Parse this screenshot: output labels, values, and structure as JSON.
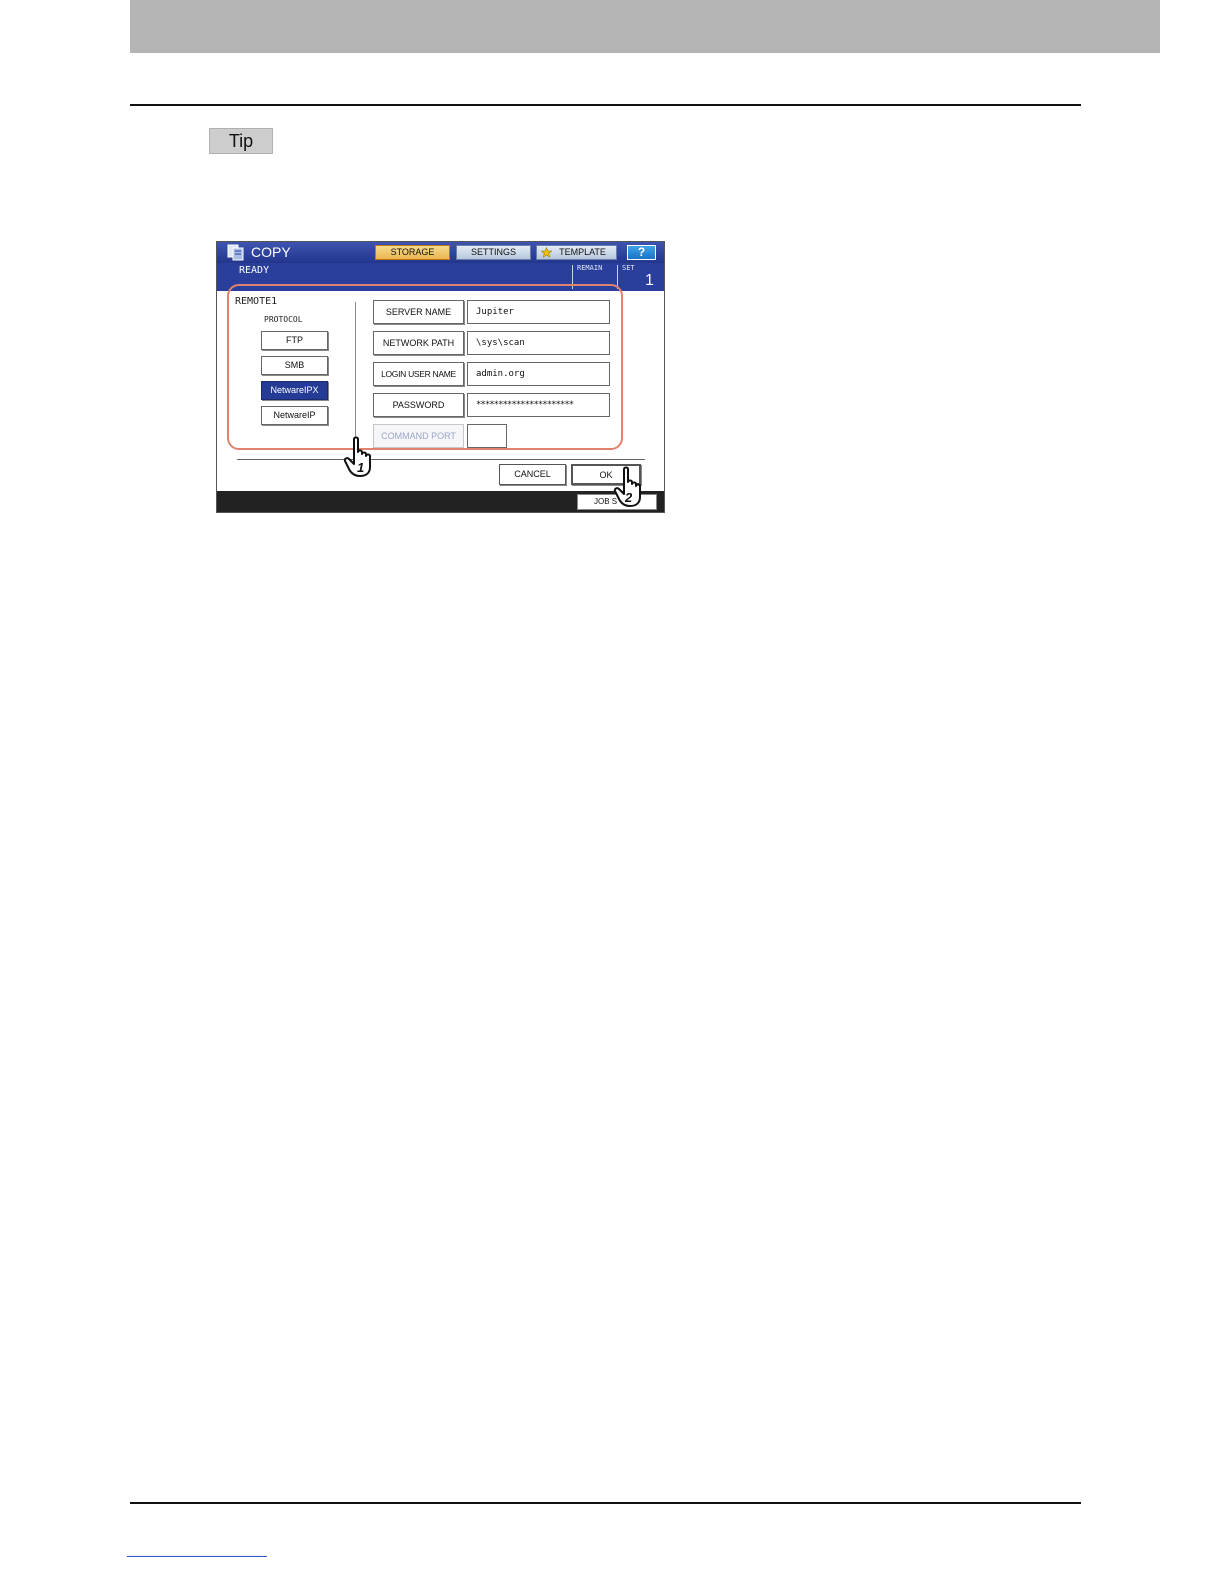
{
  "page": {
    "tip_label": "Tip"
  },
  "panel": {
    "app_title": "COPY",
    "top_buttons": {
      "storage": "STORAGE",
      "settings": "SETTINGS",
      "template": "TEMPLATE",
      "help": "?"
    },
    "status": {
      "text": "READY",
      "remain_label": "REMAIN",
      "set_label": "SET",
      "set_value": "1"
    },
    "remote_title": "REMOTE1",
    "protocol_label": "PROTOCOL",
    "protocols": [
      "FTP",
      "SMB",
      "NetwareIPX",
      "NetwareIP"
    ],
    "selected_protocol": "NetwareIPX",
    "fields": {
      "server_name": {
        "label": "SERVER NAME",
        "value": "Jupiter"
      },
      "network_path": {
        "label": "NETWORK PATH",
        "value": "\\sys\\scan"
      },
      "login_user_name": {
        "label": "LOGIN USER NAME",
        "value": "admin.org"
      },
      "password": {
        "label": "PASSWORD",
        "value": "**********************"
      },
      "command_port": {
        "label": "COMMAND PORT",
        "value": ""
      }
    },
    "actions": {
      "cancel": "CANCEL",
      "ok": "OK"
    },
    "bottom": {
      "job_status": "JOB S"
    },
    "callouts": {
      "step1": "1",
      "step2": "2"
    }
  },
  "colors": {
    "highlight": "#e0826e",
    "selected_button": "#243c96",
    "status_bar": "#2a3f9c",
    "header_band": "#b4b4b4"
  }
}
